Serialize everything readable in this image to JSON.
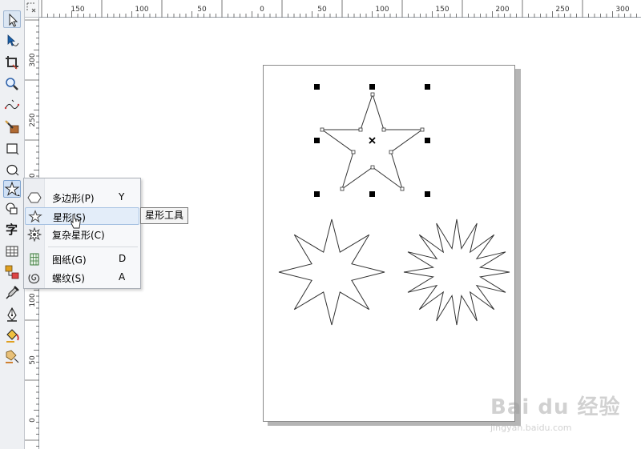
{
  "toolbox": {
    "tools": [
      {
        "name": "pick-tool",
        "icon": "arrow-pointer-icon"
      },
      {
        "name": "shape-tool",
        "icon": "node-edit-icon"
      },
      {
        "name": "crop-tool",
        "icon": "crop-icon"
      },
      {
        "name": "zoom-tool",
        "icon": "magnifier-icon"
      },
      {
        "name": "freehand-tool",
        "icon": "freehand-curve-icon"
      },
      {
        "name": "smart-fill-tool",
        "icon": "smart-fill-icon"
      },
      {
        "name": "rectangle-tool",
        "icon": "rectangle-icon"
      },
      {
        "name": "ellipse-tool",
        "icon": "ellipse-icon"
      },
      {
        "name": "polygon-star-tool",
        "icon": "star-icon"
      },
      {
        "name": "basic-shapes-tool",
        "icon": "basic-shapes-icon"
      },
      {
        "name": "text-tool",
        "icon": "text-icon",
        "glyph": "字"
      },
      {
        "name": "table-tool",
        "icon": "table-icon"
      },
      {
        "name": "connector-tool",
        "icon": "connector-icon"
      },
      {
        "name": "eyedropper-tool",
        "icon": "eyedropper-icon"
      },
      {
        "name": "outline-pen-tool",
        "icon": "pen-nib-icon"
      },
      {
        "name": "fill-tool",
        "icon": "paint-bucket-icon"
      },
      {
        "name": "interactive-fill-tool",
        "icon": "interactive-fill-icon"
      }
    ]
  },
  "rulers": {
    "horizontal": [
      "150",
      "100",
      "50",
      "0",
      "50",
      "100",
      "150",
      "200",
      "250",
      "300"
    ],
    "vertical": [
      "300",
      "250",
      "200",
      "150",
      "100",
      "50",
      "0"
    ]
  },
  "flyout": {
    "items": [
      {
        "label": "多边形(P)",
        "shortcut": "Y",
        "icon": "polygon-icon"
      },
      {
        "label": "星形(S)",
        "shortcut": "",
        "icon": "star-icon"
      },
      {
        "label": "复杂星形(C)",
        "shortcut": "",
        "icon": "complex-star-icon"
      },
      {
        "label": "图纸(G)",
        "shortcut": "D",
        "icon": "graph-paper-icon"
      },
      {
        "label": "螺纹(S)",
        "shortcut": "A",
        "icon": "spiral-icon"
      }
    ]
  },
  "tooltip": {
    "text": "星形工具"
  },
  "watermark": {
    "main": "Bai du 经验",
    "sub": "jingyan.baidu.com"
  },
  "colors": {
    "selection_handle": "#000000",
    "shape_outline": "#333333",
    "page_shadow": "#b5b5b5",
    "menu_highlight": "#e3edf9"
  }
}
